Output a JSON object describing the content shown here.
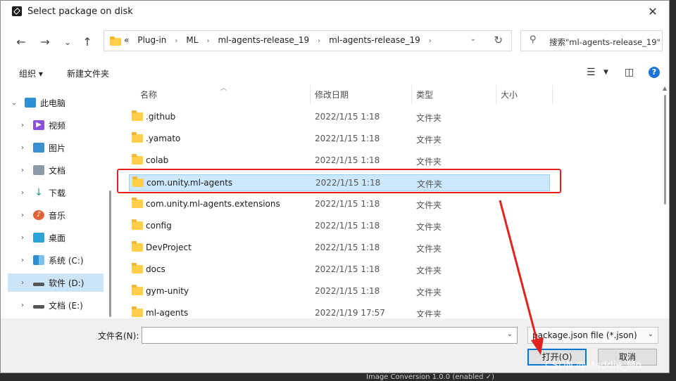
{
  "window": {
    "title": "Select package on disk",
    "close": "✕"
  },
  "nav": {
    "back": "←",
    "forward": "→",
    "recent": "⌄",
    "up": "↑",
    "crumbs": [
      "«",
      "Plug-in",
      "ML",
      "ml-agents-release_19",
      "ml-agents-release_19"
    ],
    "refresh": "↻",
    "search_placeholder": "搜索\"ml-agents-release_19\""
  },
  "toolbar": {
    "organize": "组织 ▾",
    "new_folder": "新建文件夹",
    "help": "?"
  },
  "sidebar": {
    "items": [
      {
        "label": "此电脑",
        "icon": "computer-icon",
        "color": "#2e8fd6"
      },
      {
        "label": "视频",
        "icon": "video-icon",
        "color": "#8a4fd8"
      },
      {
        "label": "图片",
        "icon": "picture-icon",
        "color": "#3a8fd0"
      },
      {
        "label": "文档",
        "icon": "document-icon",
        "color": "#8b99a8"
      },
      {
        "label": "下载",
        "icon": "download-icon",
        "color": "#1f9d6b"
      },
      {
        "label": "音乐",
        "icon": "music-icon",
        "color": "#e0663a"
      },
      {
        "label": "桌面",
        "icon": "desktop-icon",
        "color": "#2aa3d8"
      },
      {
        "label": "系统 (C:)",
        "icon": "windows-drive-icon",
        "color": "#2e8fd6"
      },
      {
        "label": "软件 (D:)",
        "icon": "drive-icon",
        "color": "#555555"
      },
      {
        "label": "文档 (E:)",
        "icon": "drive-icon",
        "color": "#555555"
      }
    ]
  },
  "columns": {
    "name": "名称",
    "modified": "修改日期",
    "type": "类型",
    "size": "大小"
  },
  "files": [
    {
      "name": ".github",
      "date": "2022/1/15 1:18",
      "type": "文件夹"
    },
    {
      "name": ".yamato",
      "date": "2022/1/15 1:18",
      "type": "文件夹"
    },
    {
      "name": "colab",
      "date": "2022/1/15 1:18",
      "type": "文件夹"
    },
    {
      "name": "com.unity.ml-agents",
      "date": "2022/1/15 1:18",
      "type": "文件夹"
    },
    {
      "name": "com.unity.ml-agents.extensions",
      "date": "2022/1/15 1:18",
      "type": "文件夹"
    },
    {
      "name": "config",
      "date": "2022/1/15 1:18",
      "type": "文件夹"
    },
    {
      "name": "DevProject",
      "date": "2022/1/15 1:18",
      "type": "文件夹"
    },
    {
      "name": "docs",
      "date": "2022/1/15 1:18",
      "type": "文件夹"
    },
    {
      "name": "gym-unity",
      "date": "2022/1/15 1:18",
      "type": "文件夹"
    },
    {
      "name": "ml-agents",
      "date": "2022/1/19 17:57",
      "type": "文件夹"
    }
  ],
  "selected_file_index": 3,
  "selected_sidebar_index": 8,
  "bottom": {
    "filename_label": "文件名(N):",
    "filename_value": "",
    "filter": "package.json file (*.json)",
    "open": "打开(O)",
    "cancel": "取消"
  },
  "overlay": {
    "watermark": "CSDN @Maddie_Mo",
    "background_text": "Image Conversion   1.0.0   (enabled ✓)"
  },
  "colors": {
    "annotation": "#e0231c",
    "selection": "#cce8ff",
    "accent": "#0078d7"
  }
}
